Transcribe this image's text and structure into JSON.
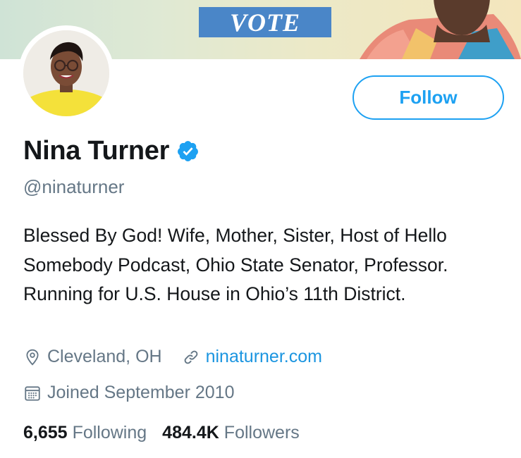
{
  "banner": {
    "vote_text": "VOTE"
  },
  "profile": {
    "name": "Nina Turner",
    "handle": "@ninaturner",
    "verified": true,
    "bio": "Blessed By God! Wife, Mother, Sister, Host of Hello Somebody Podcast, Ohio State Senator, Professor. Running for U.S. House in Ohio’s 11th District.",
    "location": "Cleveland, OH",
    "website": "ninaturner.com",
    "joined": "Joined September 2010"
  },
  "actions": {
    "follow_label": "Follow"
  },
  "stats": {
    "following_count": "6,655",
    "following_label": "Following",
    "followers_count": "484.4K",
    "followers_label": "Followers"
  },
  "icons": {
    "location": "location-pin-icon",
    "link": "link-icon",
    "calendar": "calendar-icon",
    "verified": "verified-badge-icon"
  },
  "colors": {
    "accent": "#1da1f2",
    "link": "#1b95e0",
    "secondary_text": "#657786",
    "primary_text": "#14171a",
    "vote_banner": "#4a86c8"
  }
}
